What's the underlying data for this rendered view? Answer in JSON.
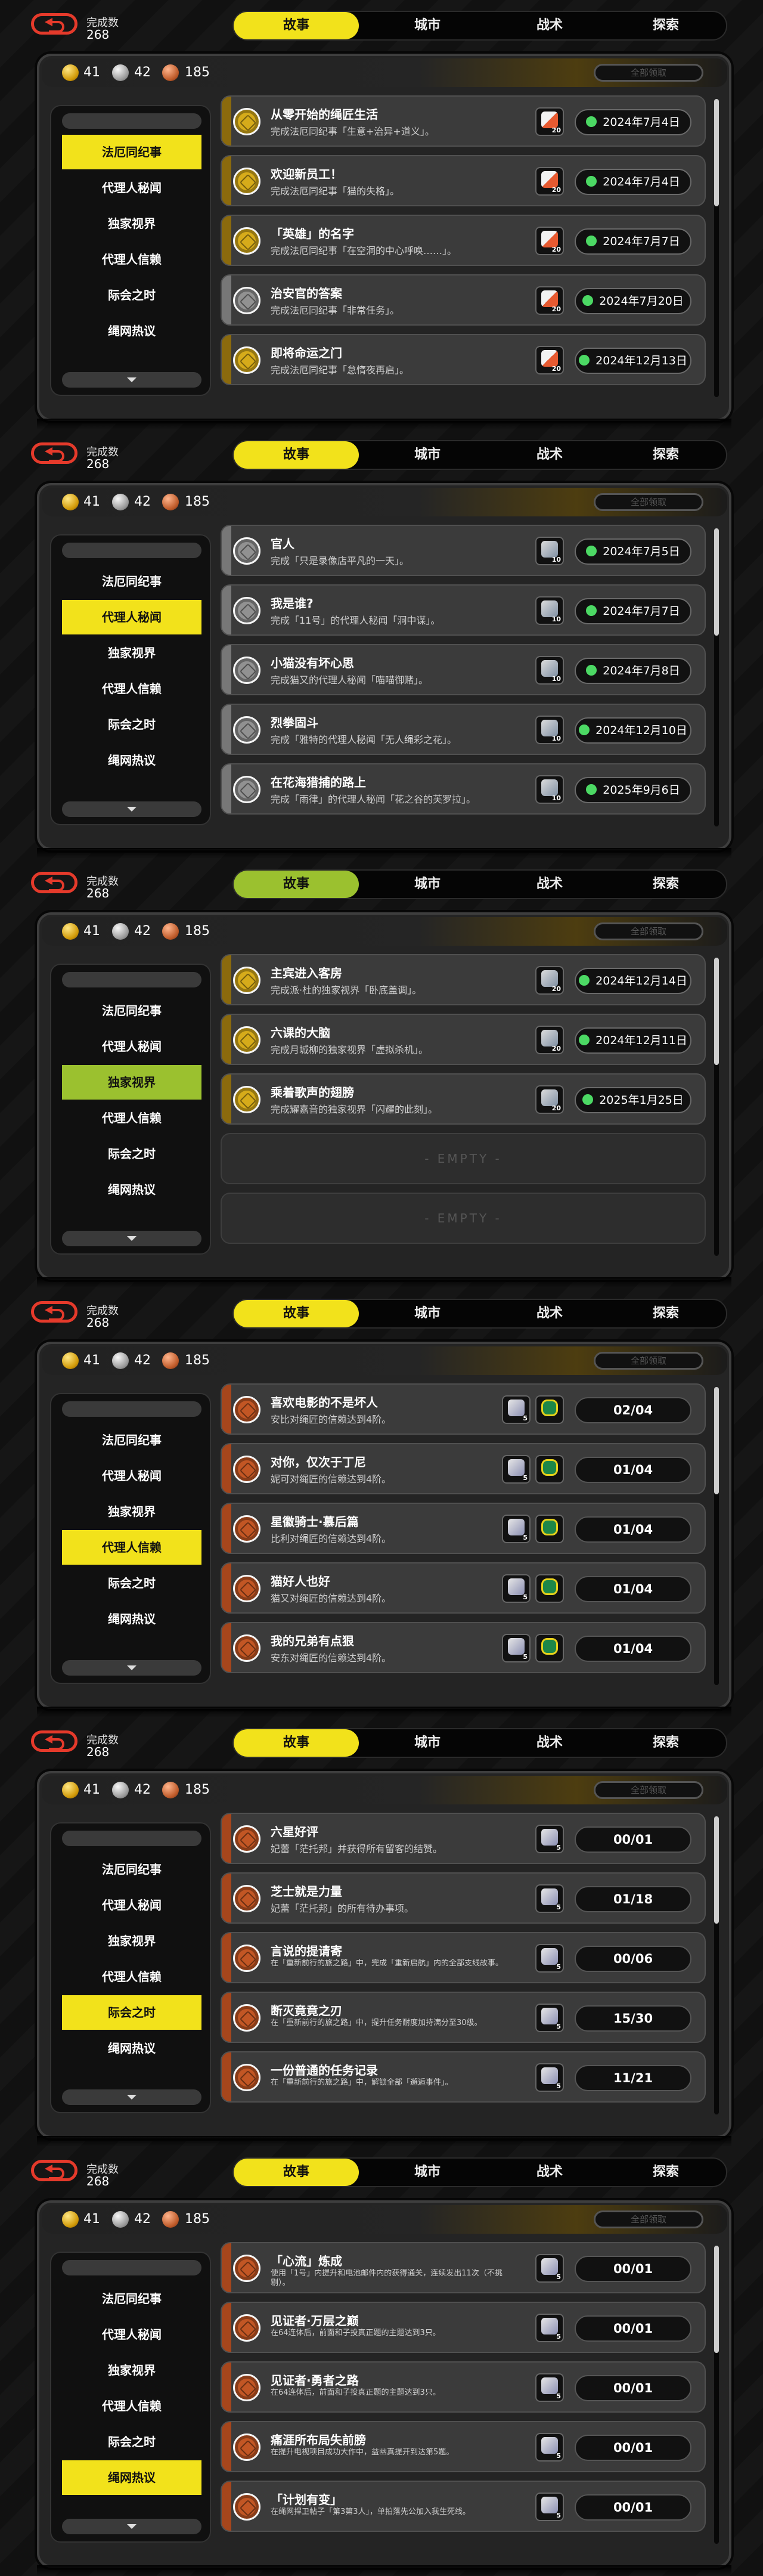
{
  "accent": "#f2e21b",
  "accent_green": "#9bc12f",
  "done_label": "完成数",
  "done_count": "268",
  "tabs": [
    "故事",
    "城市",
    "战术",
    "探索"
  ],
  "counts": {
    "gold": "41",
    "silver": "42",
    "bronze": "185"
  },
  "claim_all": "全部领取",
  "categories": [
    "法厄同纪事",
    "代理人秘闻",
    "独家视界",
    "代理人信赖",
    "际会之时",
    "绳网热议"
  ],
  "empty_label": "- EMPTY -",
  "screens": [
    {
      "active_cat": 0,
      "rows": [
        {
          "tier": "g",
          "title": "从零开始的绳匠生活",
          "desc": "完成法厄同纪事「生意+治异+道义」。",
          "reward": "badge",
          "reward_num": "20",
          "date": "2024年7月4日"
        },
        {
          "tier": "g",
          "title": "欢迎新员工！",
          "desc": "完成法厄同纪事「猫的失格」。",
          "reward": "badge",
          "reward_num": "20",
          "date": "2024年7月4日"
        },
        {
          "tier": "g",
          "title": "「英雄」的名字",
          "desc": "完成法厄同纪事「在空洞的中心呼唤……」。",
          "reward": "badge",
          "reward_num": "20",
          "date": "2024年7月7日"
        },
        {
          "tier": "s",
          "title": "治安官的答案",
          "desc": "完成法厄同纪事「非常任务」。",
          "reward": "badge",
          "reward_num": "20",
          "date": "2024年7月20日"
        },
        {
          "tier": "g",
          "title": "即将命运之门",
          "desc": "完成法厄同纪事「怠惰夜再启」。",
          "reward": "badge",
          "reward_num": "20",
          "date": "2024年12月13日"
        }
      ]
    },
    {
      "active_cat": 1,
      "rows": [
        {
          "tier": "s",
          "title": "官人",
          "desc": "完成「只是录像店平凡的一天」。",
          "reward": "ticket",
          "reward_num": "10",
          "date": "2024年7月5日"
        },
        {
          "tier": "s",
          "title": "我是谁?",
          "desc": "完成「11号」的代理人秘闻「洞中谋」。",
          "reward": "ticket",
          "reward_num": "10",
          "date": "2024年7月7日"
        },
        {
          "tier": "s",
          "title": "小猫没有坏心思",
          "desc": "完成猫又的代理人秘闻「喵喵御赌」。",
          "reward": "ticket",
          "reward_num": "10",
          "date": "2024年7月8日"
        },
        {
          "tier": "s",
          "title": "烈拳固斗",
          "desc": "完成「雅特的代理人秘闻「无人绳彩之花」。",
          "reward": "ticket",
          "reward_num": "10",
          "date": "2024年12月10日"
        },
        {
          "tier": "s",
          "title": "在花海猎捕的路上",
          "desc": "完成「雨律」的代理人秘闻「花之谷的芙罗拉」。",
          "reward": "ticket",
          "reward_num": "10",
          "date": "2025年9月6日"
        }
      ]
    },
    {
      "active_cat": 2,
      "rows": [
        {
          "tier": "g",
          "title": "主宾进入客房",
          "desc": "完成派·杜的独家视界「卧底盖调」。",
          "reward": "ticket",
          "reward_num": "20",
          "date": "2024年12月14日"
        },
        {
          "tier": "g",
          "title": "六课的大脑",
          "desc": "完成月城柳的独家视界「虚拟杀机」。",
          "reward": "ticket",
          "reward_num": "20",
          "date": "2024年12月11日"
        },
        {
          "tier": "g",
          "title": "乘着歌声的翅膀",
          "desc": "完成耀嘉音的独家视界「闪耀的此刻」。",
          "reward": "ticket",
          "reward_num": "20",
          "date": "2025年1月25日"
        }
      ],
      "empty_rows": 2
    },
    {
      "active_cat": 3,
      "rows": [
        {
          "tier": "b",
          "title": "喜欢电影的不是坏人",
          "desc": "安比对绳匠的信赖达到4阶。",
          "reward": "ticket2",
          "reward_num": "5",
          "reward2": "bolt",
          "progress": "02/04"
        },
        {
          "tier": "b",
          "title": "对你，仅次于丁尼",
          "desc": "妮可对绳匠的信赖达到4阶。",
          "reward": "ticket2",
          "reward_num": "5",
          "reward2": "bolt",
          "progress": "01/04"
        },
        {
          "tier": "b",
          "title": "星徽骑士·慕后篇",
          "desc": "比利对绳匠的信赖达到4阶。",
          "reward": "ticket2",
          "reward_num": "5",
          "reward2": "bolt",
          "progress": "01/04"
        },
        {
          "tier": "b",
          "title": "猫好人也好",
          "desc": "猫又对绳匠的信赖达到4阶。",
          "reward": "ticket2",
          "reward_num": "5",
          "reward2": "bolt",
          "progress": "01/04"
        },
        {
          "tier": "b",
          "title": "我的兄弟有点狠",
          "desc": "安东对绳匠的信赖达到4阶。",
          "reward": "ticket2",
          "reward_num": "5",
          "reward2": "bolt",
          "progress": "01/04"
        }
      ]
    },
    {
      "active_cat": 4,
      "rows": [
        {
          "tier": "b",
          "title": "六星好评",
          "desc": "妃蕾「茫托邦」并获得所有留客的结赞。",
          "reward": "ticket2",
          "reward_num": "5",
          "progress": "00/01"
        },
        {
          "tier": "b",
          "title": "芝士就是力量",
          "desc": "妃蕾「茫托邦」的所有待办事项。",
          "reward": "ticket2",
          "reward_num": "5",
          "progress": "01/18"
        },
        {
          "tier": "b",
          "title": "言说的提请寄",
          "desc": "在「重新前行的旅之路」中，完成「重新启航」内的全部支线故事。",
          "reward": "ticket2",
          "reward_num": "5",
          "progress": "00/06",
          "small": true
        },
        {
          "tier": "b",
          "title": "断灭竟竟之刃",
          "desc": "在「重新前行的旅之路」中，提升任务耐度加持满分至30级。",
          "reward": "ticket2",
          "reward_num": "5",
          "progress": "15/30",
          "small": true
        },
        {
          "tier": "b",
          "title": "一份普通的任务记录",
          "desc": "在「重新前行的旅之路」中，解锁全部「邂逅事件」。",
          "reward": "ticket2",
          "reward_num": "5",
          "progress": "11/21",
          "small": true
        }
      ]
    },
    {
      "active_cat": 5,
      "rows": [
        {
          "tier": "b",
          "title": "「心流」炼成",
          "desc": "使用「1号」内提升和电池邮件内的获得通关，连续发出11次（不挑剔）。",
          "reward": "ticket2",
          "reward_num": "5",
          "progress": "00/01",
          "small": true
        },
        {
          "tier": "b",
          "title": "见证者·万层之巅",
          "desc": "在64连体后，前面和子投真正题的主题达到3只。",
          "reward": "ticket2",
          "reward_num": "5",
          "progress": "00/01",
          "small": true
        },
        {
          "tier": "b",
          "title": "见证者·勇者之路",
          "desc": "在64连体后，前面和子投真正题的主题达到3只。",
          "reward": "ticket2",
          "reward_num": "5",
          "progress": "00/01",
          "small": true
        },
        {
          "tier": "b",
          "title": "痛涯所布局失前膀",
          "desc": "在提升电视项目成功大作中，益幽真提开到达第5题。",
          "reward": "ticket2",
          "reward_num": "5",
          "progress": "00/01",
          "small": true
        },
        {
          "tier": "b",
          "title": "「计划有变」",
          "desc": "在绳网捍卫帖子「第3第3人」，单拍落先公加入我生死线。",
          "reward": "ticket2",
          "reward_num": "5",
          "progress": "00/01",
          "small": true
        }
      ]
    }
  ]
}
